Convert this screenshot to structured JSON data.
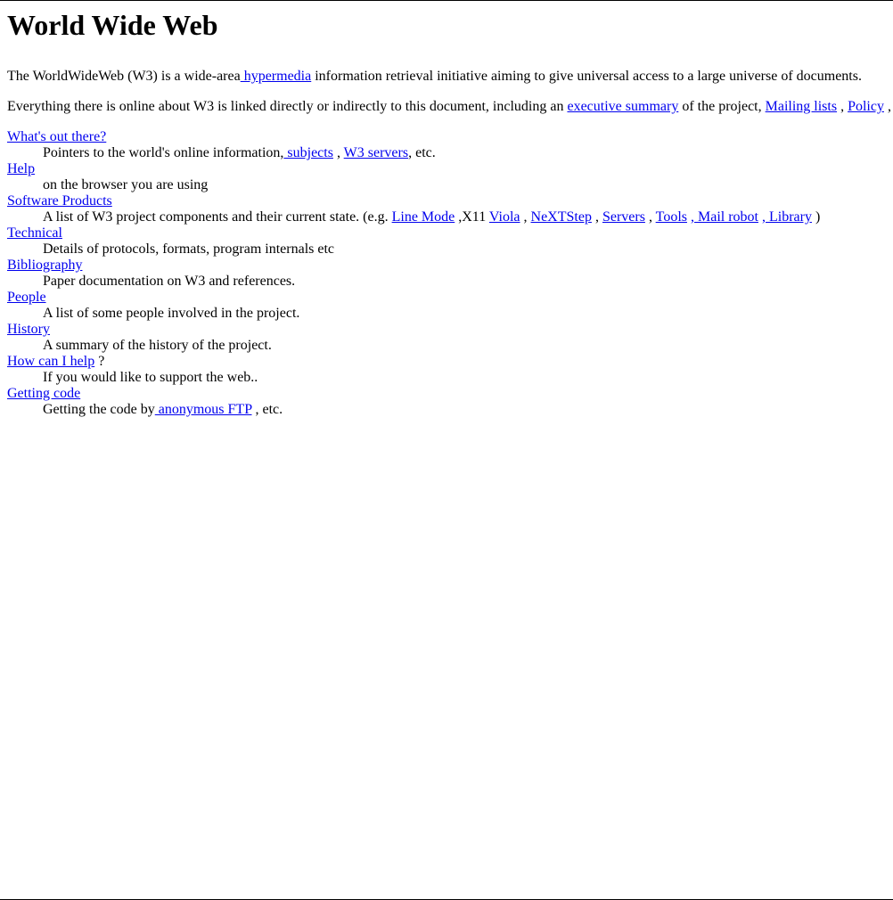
{
  "page": {
    "title": "World Wide Web"
  },
  "intro": {
    "p1_prefix": "The WorldWideWeb (W3) is a wide-area",
    "p1_link_hypermedia": " hypermedia",
    "p1_suffix": " information retrieval initiative aiming to give universal access to a large universe of documents.",
    "p2_prefix": "Everything there is online about W3 is linked directly or indirectly to this document, including an ",
    "p2_link_executive_summary": "executive summary",
    "p2_mid1": " of the project, ",
    "p2_link_mailing_lists": "Mailing lists",
    "p2_mid2": " , ",
    "p2_link_policy": "Policy",
    "p2_suffix": " ,"
  },
  "sections": {
    "whats_out_there": {
      "title": "What's out there?",
      "desc_prefix": "Pointers to the world's online information,",
      "link_subjects": " subjects",
      "sep1": " , ",
      "link_w3_servers": "W3 servers",
      "desc_suffix": ", etc."
    },
    "help": {
      "title": "Help",
      "desc": "on the browser you are using"
    },
    "software_products": {
      "title": "Software Products",
      "desc_prefix": "A list of W3 project components and their current state. (e.g. ",
      "link_line_mode": "Line Mode",
      "sep1": " ,X11 ",
      "link_viola": "Viola",
      "sep2": " , ",
      "link_nextstep": "NeXTStep",
      "sep3": " , ",
      "link_servers": "Servers",
      "sep4": " , ",
      "link_tools": "Tools",
      "sep5": " ",
      "link_mail_robot": ", Mail robot",
      "sep6": " ",
      "link_library": ", Library",
      "desc_suffix": " )"
    },
    "technical": {
      "title": "Technical",
      "desc": "Details of protocols, formats, program internals etc"
    },
    "bibliography": {
      "title": "Bibliography",
      "desc": "Paper documentation on W3 and references."
    },
    "people": {
      "title": "People",
      "desc": "A list of some people involved in the project."
    },
    "history": {
      "title": "History",
      "desc": "A summary of the history of the project."
    },
    "how_can_i_help": {
      "title": "How can I help",
      "title_suffix": " ?",
      "desc": "If you would like to support the web.."
    },
    "getting_code": {
      "title": "Getting code",
      "desc_prefix": "Getting the code by",
      "link_anonymous_ftp": " anonymous FTP",
      "desc_suffix": " , etc."
    }
  },
  "colors": {
    "link": "#0000ee",
    "text": "#000000",
    "background": "#ffffff"
  }
}
